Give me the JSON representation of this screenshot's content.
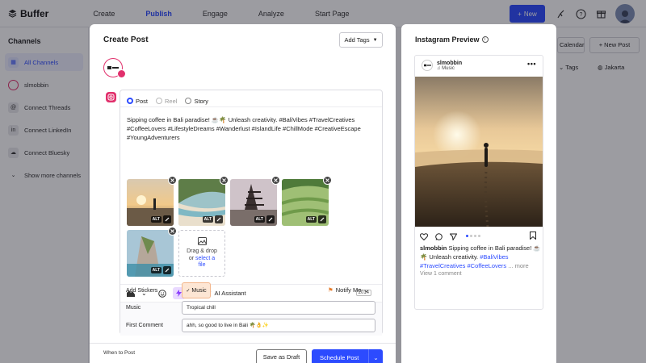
{
  "app": {
    "brand": "Buffer",
    "nav": [
      "Create",
      "Publish",
      "Engage",
      "Analyze",
      "Start Page"
    ],
    "active_nav": "Publish",
    "new_button": "New"
  },
  "sidebar": {
    "heading": "Channels",
    "items": [
      {
        "label": "All Channels",
        "active": true
      },
      {
        "label": "slmobbin",
        "active": false
      },
      {
        "label": "Connect Threads",
        "active": false
      },
      {
        "label": "Connect LinkedIn",
        "active": false
      },
      {
        "label": "Connect Bluesky",
        "active": false
      },
      {
        "label": "Show more channels",
        "active": false
      }
    ]
  },
  "background_right": {
    "calendar": "Calendar",
    "new_post": "New Post",
    "tags": "Tags",
    "timezone": "Jakarta"
  },
  "create_post": {
    "title": "Create Post",
    "add_tags": "Add Tags",
    "post_types": [
      {
        "label": "Post",
        "selected": true,
        "enabled": true
      },
      {
        "label": "Reel",
        "selected": false,
        "enabled": false
      },
      {
        "label": "Story",
        "selected": false,
        "enabled": true
      }
    ],
    "caption": "Sipping coffee in Bali paradise! ☕🌴 Unleash creativity. #BaliVibes #TravelCreatives #CoffeeLovers #LifestyleDreams #Wanderlust #IslandLife #ChillMode #CreativeEscape #YoungAdventurers",
    "alt_label": "ALT",
    "dropzone": {
      "line1": "Drag & drop",
      "or": "or",
      "link": "select a",
      "link2": "file"
    },
    "toolbar": {
      "ai_assistant": "AI Assistant",
      "char_count": "2014"
    },
    "stickers": {
      "label": "Add Stickers",
      "button": "Music",
      "notify": "Notify Me"
    },
    "music": {
      "label": "Music",
      "value": "Tropical chill"
    },
    "first_comment": {
      "label": "First Comment",
      "value": "ahh, so good to live in Bali 🌴👌✨"
    },
    "footer": {
      "when": "When to Post",
      "draft": "Save as Draft",
      "schedule": "Schedule Post"
    }
  },
  "preview": {
    "title": "Instagram Preview",
    "username": "slmobbin",
    "music": "Music",
    "caption_user": "slmobbin",
    "caption_text": "Sipping coffee in Bali paradise! ☕🌴 Unleash creativity.",
    "hashtag1": "#BaliVibes",
    "hashtag2": "#TravelCreatives",
    "hashtag3": "#CoffeeLovers",
    "more": "... more",
    "comments": "View 1 comment"
  },
  "colors": {
    "accent": "#2c4bff",
    "instagram": "#e1306c",
    "sticker_bg": "#fde6d4"
  }
}
